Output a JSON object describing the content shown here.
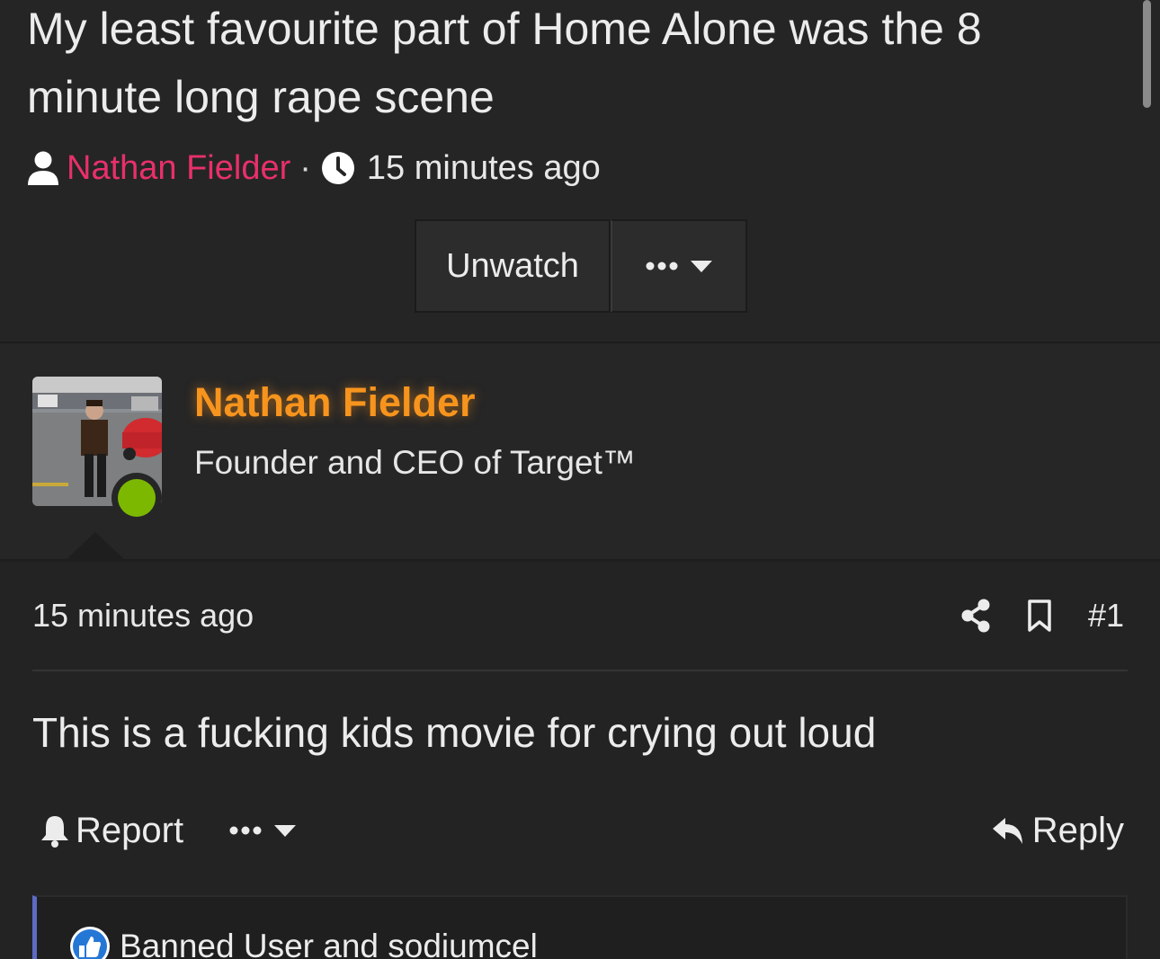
{
  "thread": {
    "title": "My least favourite part of Home Alone was the 8 minute long rape scene",
    "author": "Nathan Fielder",
    "meta_separator": "·",
    "time": "15 minutes ago",
    "unwatch_label": "Unwatch"
  },
  "post": {
    "user": {
      "name": "Nathan Fielder",
      "title": "Founder and CEO of Target™",
      "online": true
    },
    "time": "15 minutes ago",
    "number": "#1",
    "body": "This is a fucking kids movie for crying out loud",
    "report_label": "Report",
    "reply_label": "Reply",
    "reactions_text": "Banned User and sodiumcel"
  },
  "colors": {
    "background": "#232323",
    "author_link": "#e8306a",
    "username": "#f7941d",
    "online": "#7cb800",
    "reaction_accent": "#5d6bc4",
    "like": "#2577d6"
  },
  "icons": [
    "user-icon",
    "clock-icon",
    "ellipsis-icon",
    "caret-down-icon",
    "share-icon",
    "bookmark-icon",
    "bell-icon",
    "reply-icon",
    "like-icon"
  ]
}
